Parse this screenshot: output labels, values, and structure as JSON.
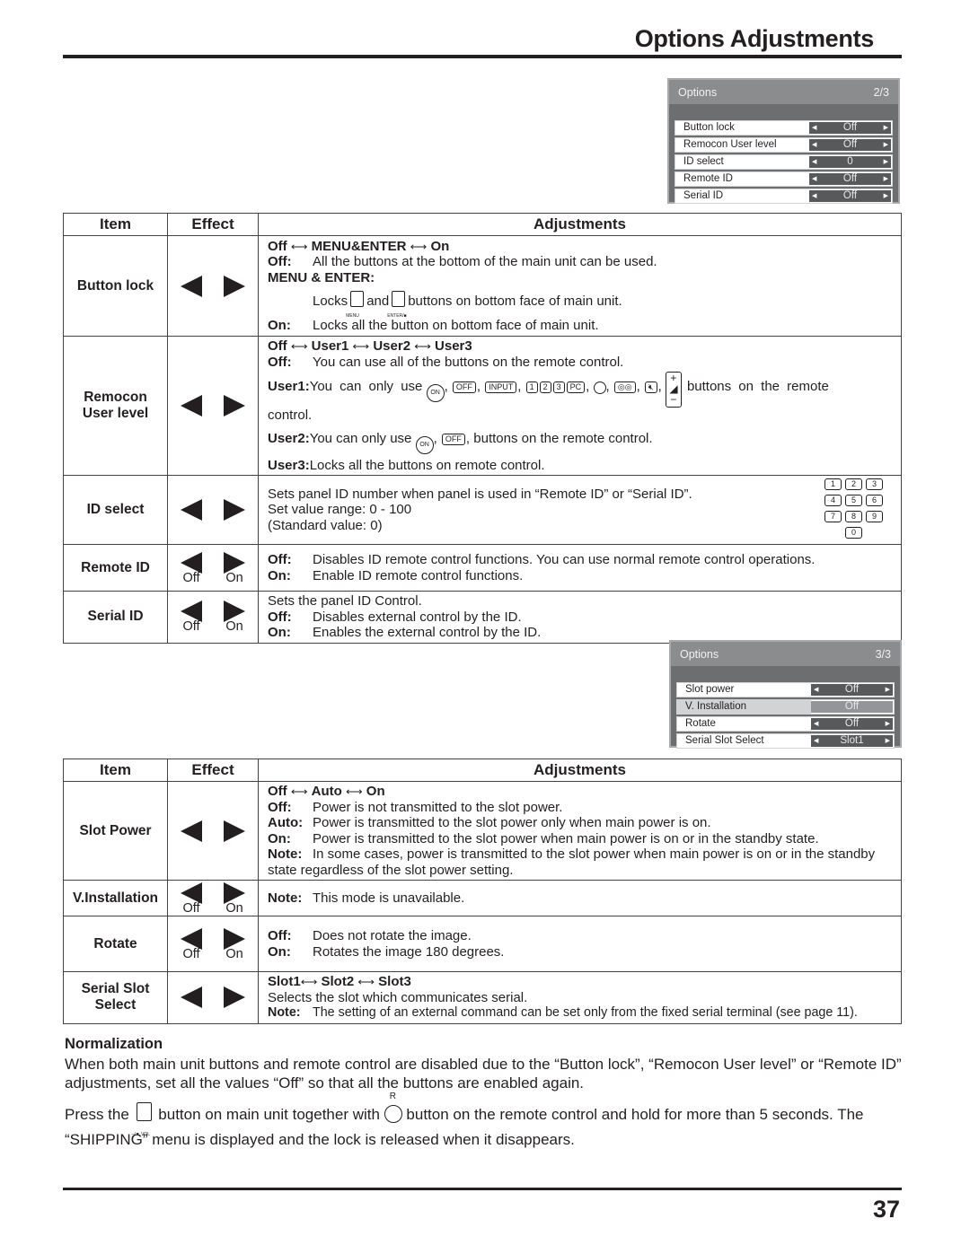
{
  "page": {
    "title": "Options Adjustments",
    "number": "37"
  },
  "osd1": {
    "title": "Options",
    "page": "2/3",
    "rows": [
      {
        "label": "Button lock",
        "value": "Off"
      },
      {
        "label": "Remocon User level",
        "value": "Off"
      },
      {
        "label": "ID select",
        "value": "0"
      },
      {
        "label": "Remote ID",
        "value": "Off"
      },
      {
        "label": "Serial ID",
        "value": "Off"
      }
    ]
  },
  "osd2": {
    "title": "Options",
    "page": "3/3",
    "rows": [
      {
        "label": "Slot power",
        "value": "Off"
      },
      {
        "label": "V. Installation",
        "value": "Off"
      },
      {
        "label": "Rotate",
        "value": "Off"
      },
      {
        "label": "Serial Slot Select",
        "value": "Slot1"
      }
    ]
  },
  "table_headers": {
    "item": "Item",
    "effect": "Effect",
    "adjustments": "Adjustments"
  },
  "effect_captions": {
    "off": "Off",
    "on": "On"
  },
  "table1": {
    "button_lock": {
      "item": "Button lock",
      "cycle": [
        "Off",
        "MENU&ENTER",
        "On"
      ],
      "off_label": "Off:",
      "off_text": "All the buttons at the bottom of the main unit can be used.",
      "me_label": "MENU & ENTER:",
      "me_text_a": "Locks",
      "me_text_b": "and",
      "me_text_c": "buttons on bottom face of main unit.",
      "menu_key": "MENU",
      "enter_key": "ENTER/■",
      "on_label": "On:",
      "on_text": "Locks all the button on bottom face of main unit."
    },
    "remocon": {
      "item_line1": "Remocon",
      "item_line2": "User level",
      "cycle": [
        "Off",
        "User1",
        "User2",
        "User3"
      ],
      "off_label": "Off:",
      "off_text": "You can use all of the buttons on the remote control.",
      "user1_label": "User1:",
      "user1_text": "You can only use",
      "user1_tail": "buttons on the remote",
      "user1_tail2": "control.",
      "user2_label": "User2:",
      "user2_text": "You can only use",
      "user2_tail": ", buttons on the remote control.",
      "user3_label": "User3:",
      "user3_text": "Locks all the buttons on remote control.",
      "keys": {
        "on": "ON",
        "off": "OFF",
        "input": "INPUT",
        "input_group": "INPUT",
        "k1": "1",
        "k2": "2",
        "k3": "3",
        "pc": "PC",
        "surround": "SURROUND",
        "vol": "VOL"
      }
    },
    "id_select": {
      "item": "ID select",
      "line1": "Sets panel ID number when panel is used in “Remote ID” or “Serial ID”.",
      "line2": "Set value range: 0 - 100",
      "line3": "(Standard value: 0)",
      "numpad": [
        "1",
        "2",
        "3",
        "4",
        "5",
        "6",
        "7",
        "8",
        "9",
        "0"
      ]
    },
    "remote_id": {
      "item": "Remote ID",
      "off_label": "Off:",
      "off_text": "Disables ID remote control functions. You can use normal remote control operations.",
      "on_label": "On:",
      "on_text": "Enable ID remote control functions."
    },
    "serial_id": {
      "item": "Serial ID",
      "intro": "Sets the panel ID Control.",
      "off_label": "Off:",
      "off_text": "Disables external control by the ID.",
      "on_label": "On:",
      "on_text": "Enables the external control by the ID."
    }
  },
  "table2": {
    "slot_power": {
      "item": "Slot Power",
      "cycle": [
        "Off",
        "Auto",
        "On"
      ],
      "off_label": "Off:",
      "off_text": "Power is not transmitted to the slot power.",
      "auto_label": "Auto:",
      "auto_text": "Power is transmitted to the slot power only when main power is on.",
      "on_label": "On:",
      "on_text": "Power is transmitted to the slot power when main power is on or in the standby state.",
      "note_label": "Note:",
      "note_text": "In some cases, power is transmitted to the slot power when main power is on or in the standby",
      "note_text2": "state regardless of the slot power setting."
    },
    "v_installation": {
      "item": "V.Installation",
      "note_label": "Note:",
      "note_text": "This mode is unavailable."
    },
    "rotate": {
      "item": "Rotate",
      "off_label": "Off:",
      "off_text": "Does not rotate the image.",
      "on_label": "On:",
      "on_text": "Rotates the image 180 degrees."
    },
    "serial_slot": {
      "item_line1": "Serial Slot",
      "item_line2": "Select",
      "cycle": [
        "Slot1",
        "Slot2",
        "Slot3"
      ],
      "text": "Selects the slot which communicates serial.",
      "note_label": "Note:",
      "note_text": "The setting of an external command can be set only from the fixed serial terminal (see page 11)."
    }
  },
  "normalization": {
    "title": "Normalization",
    "para1": "When both main unit buttons and remote control are disabled due to the “Button lock”, “Remocon User level” or “Remote ID” adjustments, set all the values “Off” so that all the buttons are enabled again.",
    "para2_a": "Press the",
    "para2_b": "button on main unit together with",
    "para2_c": "button on the remote control and hold for more than 5 seconds. The “SHIPPING” menu is displayed and the lock is released when it disappears.",
    "main_key": "–/▼ VOL",
    "remote_key": "R"
  }
}
